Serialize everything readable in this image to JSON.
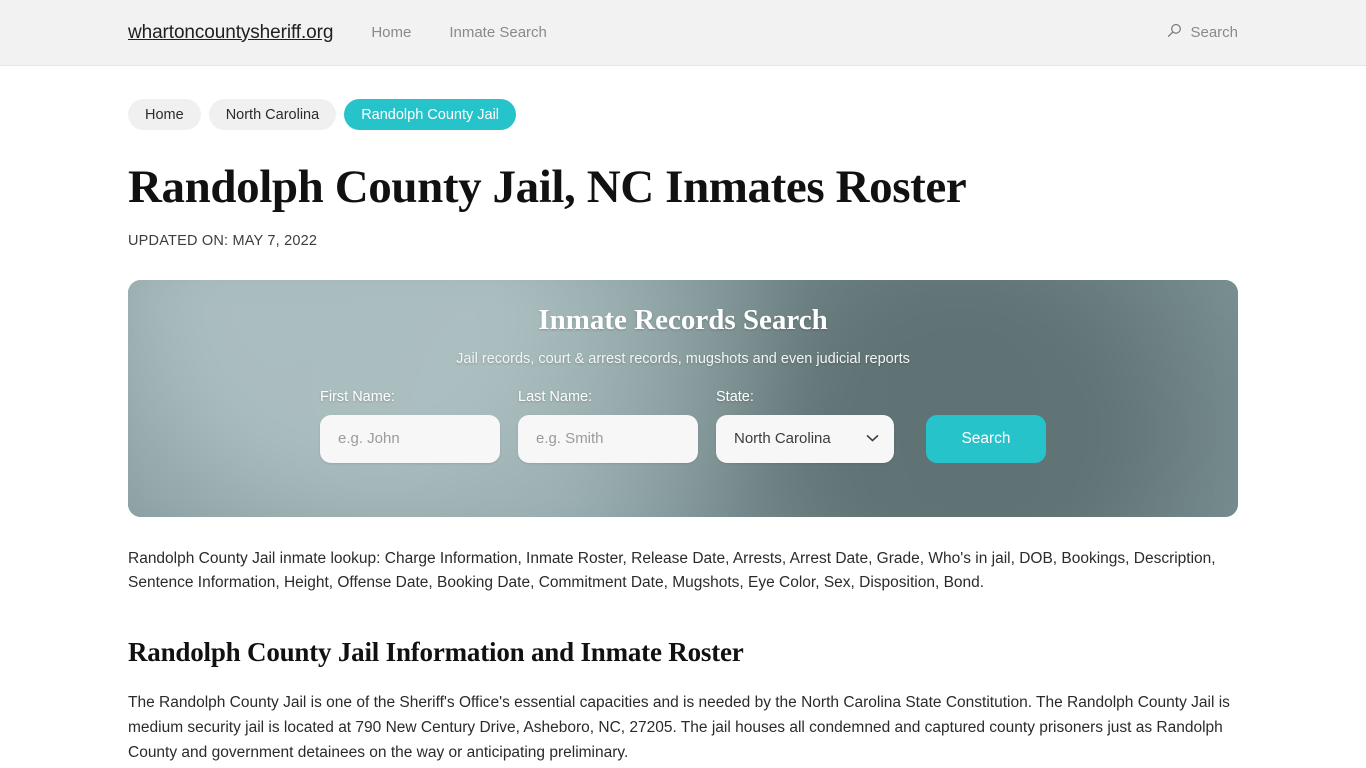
{
  "header": {
    "brand": "whartoncountysheriff.org",
    "nav": [
      {
        "label": "Home"
      },
      {
        "label": "Inmate Search"
      }
    ],
    "search_label": "Search"
  },
  "breadcrumb": [
    {
      "label": "Home",
      "active": false
    },
    {
      "label": "North Carolina",
      "active": false
    },
    {
      "label": "Randolph County Jail",
      "active": true
    }
  ],
  "page": {
    "title": "Randolph County Jail, NC Inmates Roster",
    "updated": "UPDATED ON: MAY 7, 2022"
  },
  "hero": {
    "title": "Inmate Records Search",
    "subtitle": "Jail records, court & arrest records, mugshots and even judicial reports",
    "first_name_label": "First Name:",
    "first_name_placeholder": "e.g. John",
    "first_name_value": "",
    "last_name_label": "Last Name:",
    "last_name_placeholder": "e.g. Smith",
    "last_name_value": "",
    "state_label": "State:",
    "state_selected": "North Carolina",
    "search_button": "Search"
  },
  "content": {
    "lookup_paragraph": "Randolph County Jail inmate lookup: Charge Information, Inmate Roster, Release Date, Arrests, Arrest Date, Grade, Who's in jail, DOB, Bookings, Description, Sentence Information, Height, Offense Date, Booking Date, Commitment Date, Mugshots, Eye Color, Sex, Disposition, Bond.",
    "section_heading": "Randolph County Jail Information and Inmate Roster",
    "section_paragraph": "The Randolph County Jail is one of the Sheriff's Office's essential capacities and is needed by the North Carolina State Constitution. The Randolph County Jail is medium security jail is located at 790 New Century Drive, Asheboro, NC, 27205. The jail houses all condemned and captured county prisoners just as Randolph County and government detainees on the way or anticipating preliminary."
  },
  "colors": {
    "accent": "#27c3cb",
    "header_bg": "#f2f2f2",
    "hero_bg": "#6f8a8c"
  }
}
